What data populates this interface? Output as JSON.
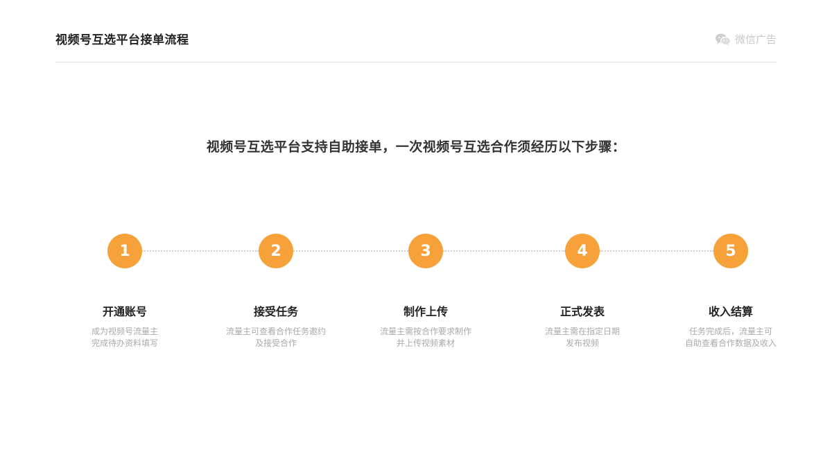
{
  "header": {
    "title": "视频号互选平台接单流程",
    "brand_label": "微信广告"
  },
  "intro": "视频号互选平台支持自助接单，一次视频号互选合作须经历以下步骤：",
  "steps": [
    {
      "number": "1",
      "title": "开通账号",
      "desc": [
        "成为视频号流量主",
        "完成待办资料填写"
      ]
    },
    {
      "number": "2",
      "title": "接受任务",
      "desc": [
        "流量主可查看合作任务邀约",
        "及接受合作"
      ]
    },
    {
      "number": "3",
      "title": "制作上传",
      "desc": [
        "流量主需按合作要求制作",
        "并上传视频素材"
      ]
    },
    {
      "number": "4",
      "title": "正式发表",
      "desc": [
        "流量主需在指定日期",
        "发布视频"
      ]
    },
    {
      "number": "5",
      "title": "收入结算",
      "desc": [
        "任务完成后，流量主可",
        "自助查看合作数据及收入"
      ]
    }
  ],
  "colors": {
    "accent": "#f7a13a",
    "connector": "#cfcfcf"
  }
}
